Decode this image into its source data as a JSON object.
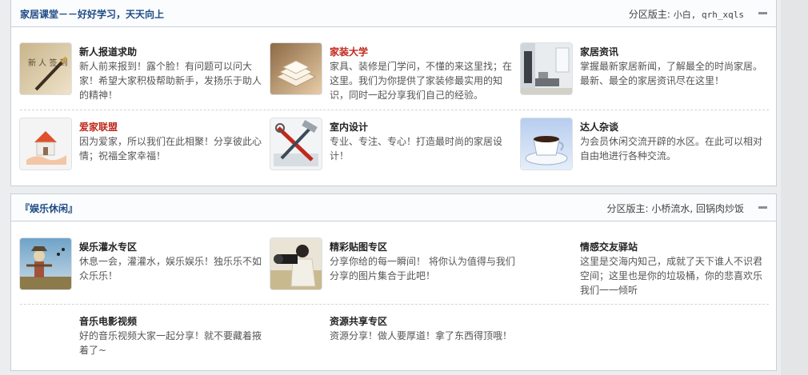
{
  "section1": {
    "title": "家居课堂－－好好学习，天天向上",
    "moderators_label": "分区版主:",
    "moderators": "小白, qrh_xqls",
    "forums": [
      {
        "name": "新人报道求助",
        "desc": "新人前来报到！露个脸！有问题可以问大家！希望大家积极帮助新手，发扬乐于助人的精神！",
        "thumb": "pen-icon"
      },
      {
        "name": "家装大学",
        "desc": "家具、装修是门学问，不懂的来这里找；在这里。我们为你提供了家装修最实用的知识，同时一起分享我们自己的经验。",
        "thumb": "book-icon"
      },
      {
        "name": "家居资讯",
        "desc": "掌握最新家居新闻，了解最全的时尚家居。最新、最全的家居资讯尽在这里！",
        "thumb": "room-icon"
      },
      {
        "name": "爱家联盟",
        "desc": "因为爱家，所以我们在此相聚！分享彼此心情；祝福全家幸福！",
        "thumb": "house-hand-icon"
      },
      {
        "name": "室内设计",
        "desc": "专业、专注、专心！打造最时尚的家居设计！",
        "thumb": "tools-icon"
      },
      {
        "name": "达人杂谈",
        "desc": "为会员休闲交流开辟的水区。在此可以相对自由地进行各种交流。",
        "thumb": "coffee-cup-icon"
      }
    ]
  },
  "section2": {
    "title": "『娱乐休闲』",
    "moderators_label": "分区版主:",
    "moderators": "小桥流水, 回锅肉炒饭",
    "forums": [
      {
        "name": "娱乐灌水专区",
        "desc": "休息一会，灌灌水，娱乐娱乐！独乐乐不如众乐乐！",
        "thumb": "scarecrow-icon"
      },
      {
        "name": "精彩贴图专区",
        "desc": "分享你给的每一瞬间！ 将你认为值得与我们分享的图片集合于此吧！",
        "thumb": "camera-person-icon"
      },
      {
        "name": "情感交友驿站",
        "desc": "这里是交海内知己，成就了天下谁人不识君空间；这里也是你的垃圾桶，你的悲喜欢乐我们一一倾听",
        "thumb": ""
      },
      {
        "name": "音乐电影视频",
        "desc": "好的音乐视频大家一起分享！就不要藏着掖着了~",
        "thumb": ""
      },
      {
        "name": "资源共享专区",
        "desc": "资源分享！做人要厚道！拿了东西得顶哦！",
        "thumb": ""
      }
    ]
  }
}
